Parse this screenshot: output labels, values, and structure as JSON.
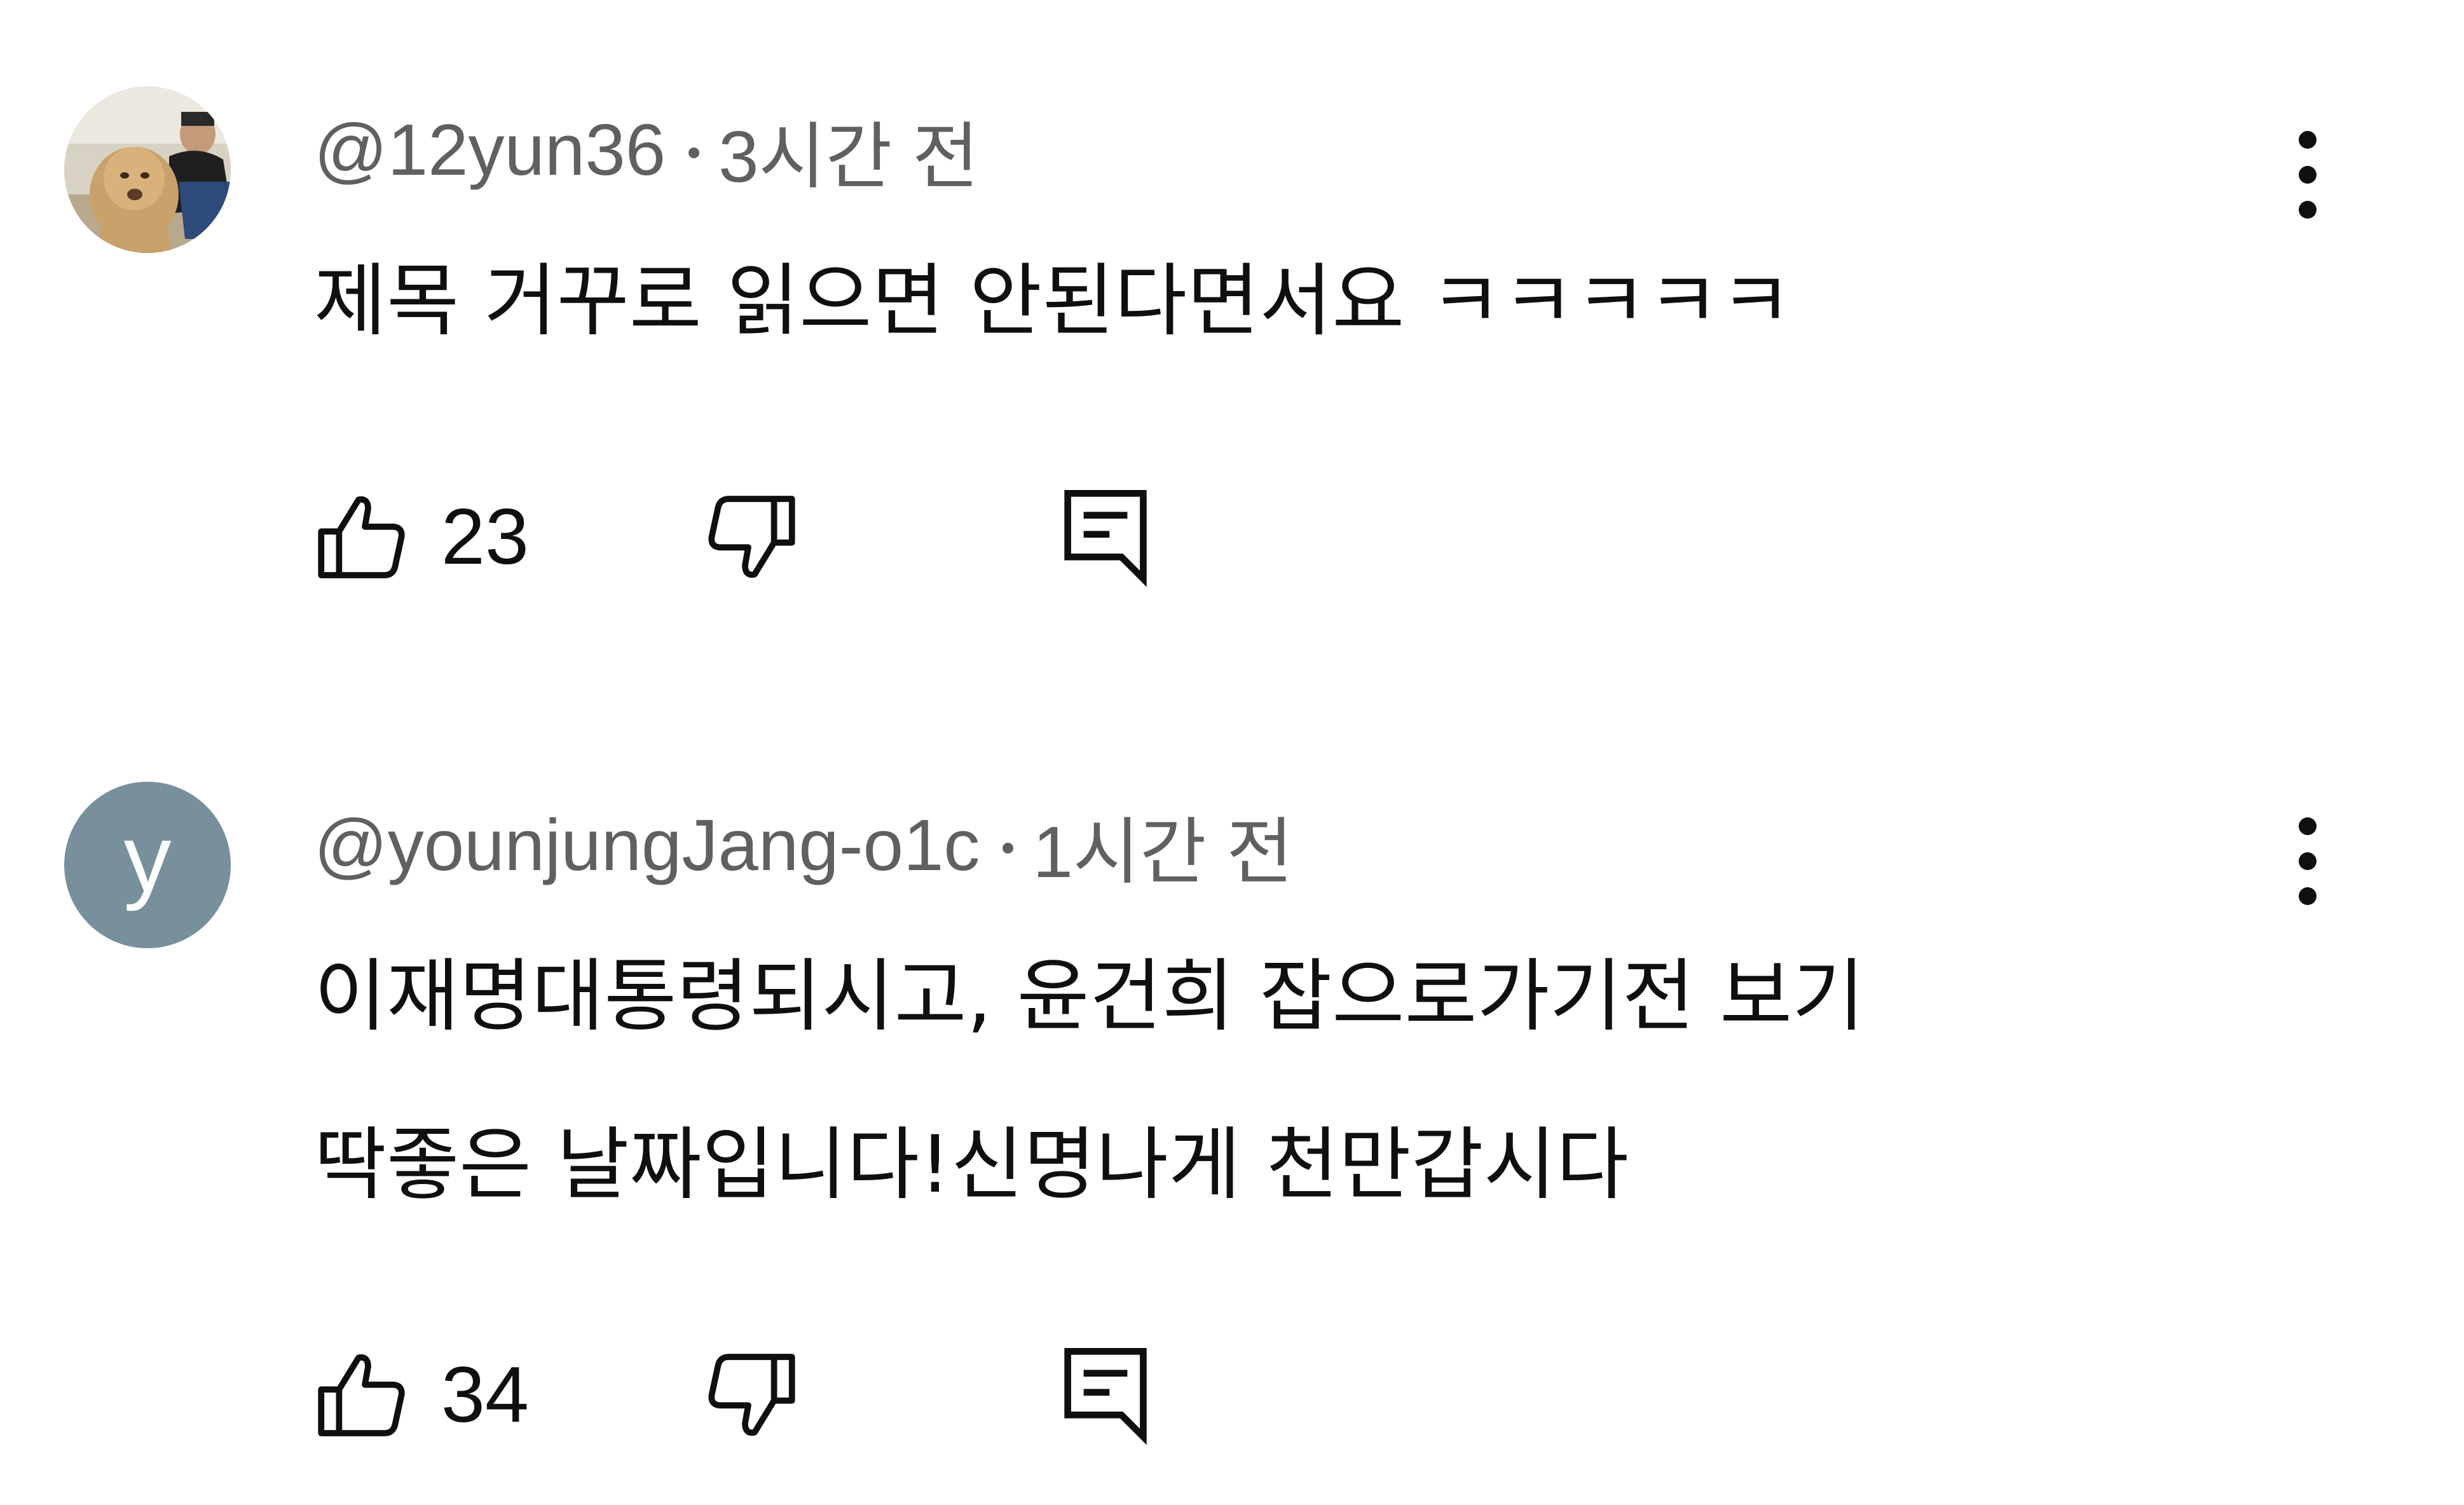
{
  "comments": [
    {
      "author": "@12yun36",
      "time": "3시간 전",
      "avatar_icon": "user-photo-avatar",
      "avatar_letter": "",
      "text_lines": [
        "제목 거꾸로 읽으면 안된다면서요 ㅋㅋㅋㅋㅋ"
      ],
      "likes": "23",
      "icons": {
        "like": "thumbs-up-icon",
        "dislike": "thumbs-down-icon",
        "reply": "reply-comment-icon",
        "more": "more-vertical-icon"
      }
    },
    {
      "author": "@younjungJang-o1c",
      "time": "1시간 전",
      "avatar_icon": "letter-avatar",
      "avatar_letter": "y",
      "avatar_color": "#78909c",
      "text_lines": [
        "이재명대통령되시고, 윤건희 잡으로가기전 보기",
        "딱좋은 날짜입니다!신명나게 천만갑시다"
      ],
      "likes": "34",
      "icons": {
        "like": "thumbs-up-icon",
        "dislike": "thumbs-down-icon",
        "reply": "reply-comment-icon",
        "more": "more-vertical-icon"
      }
    }
  ]
}
